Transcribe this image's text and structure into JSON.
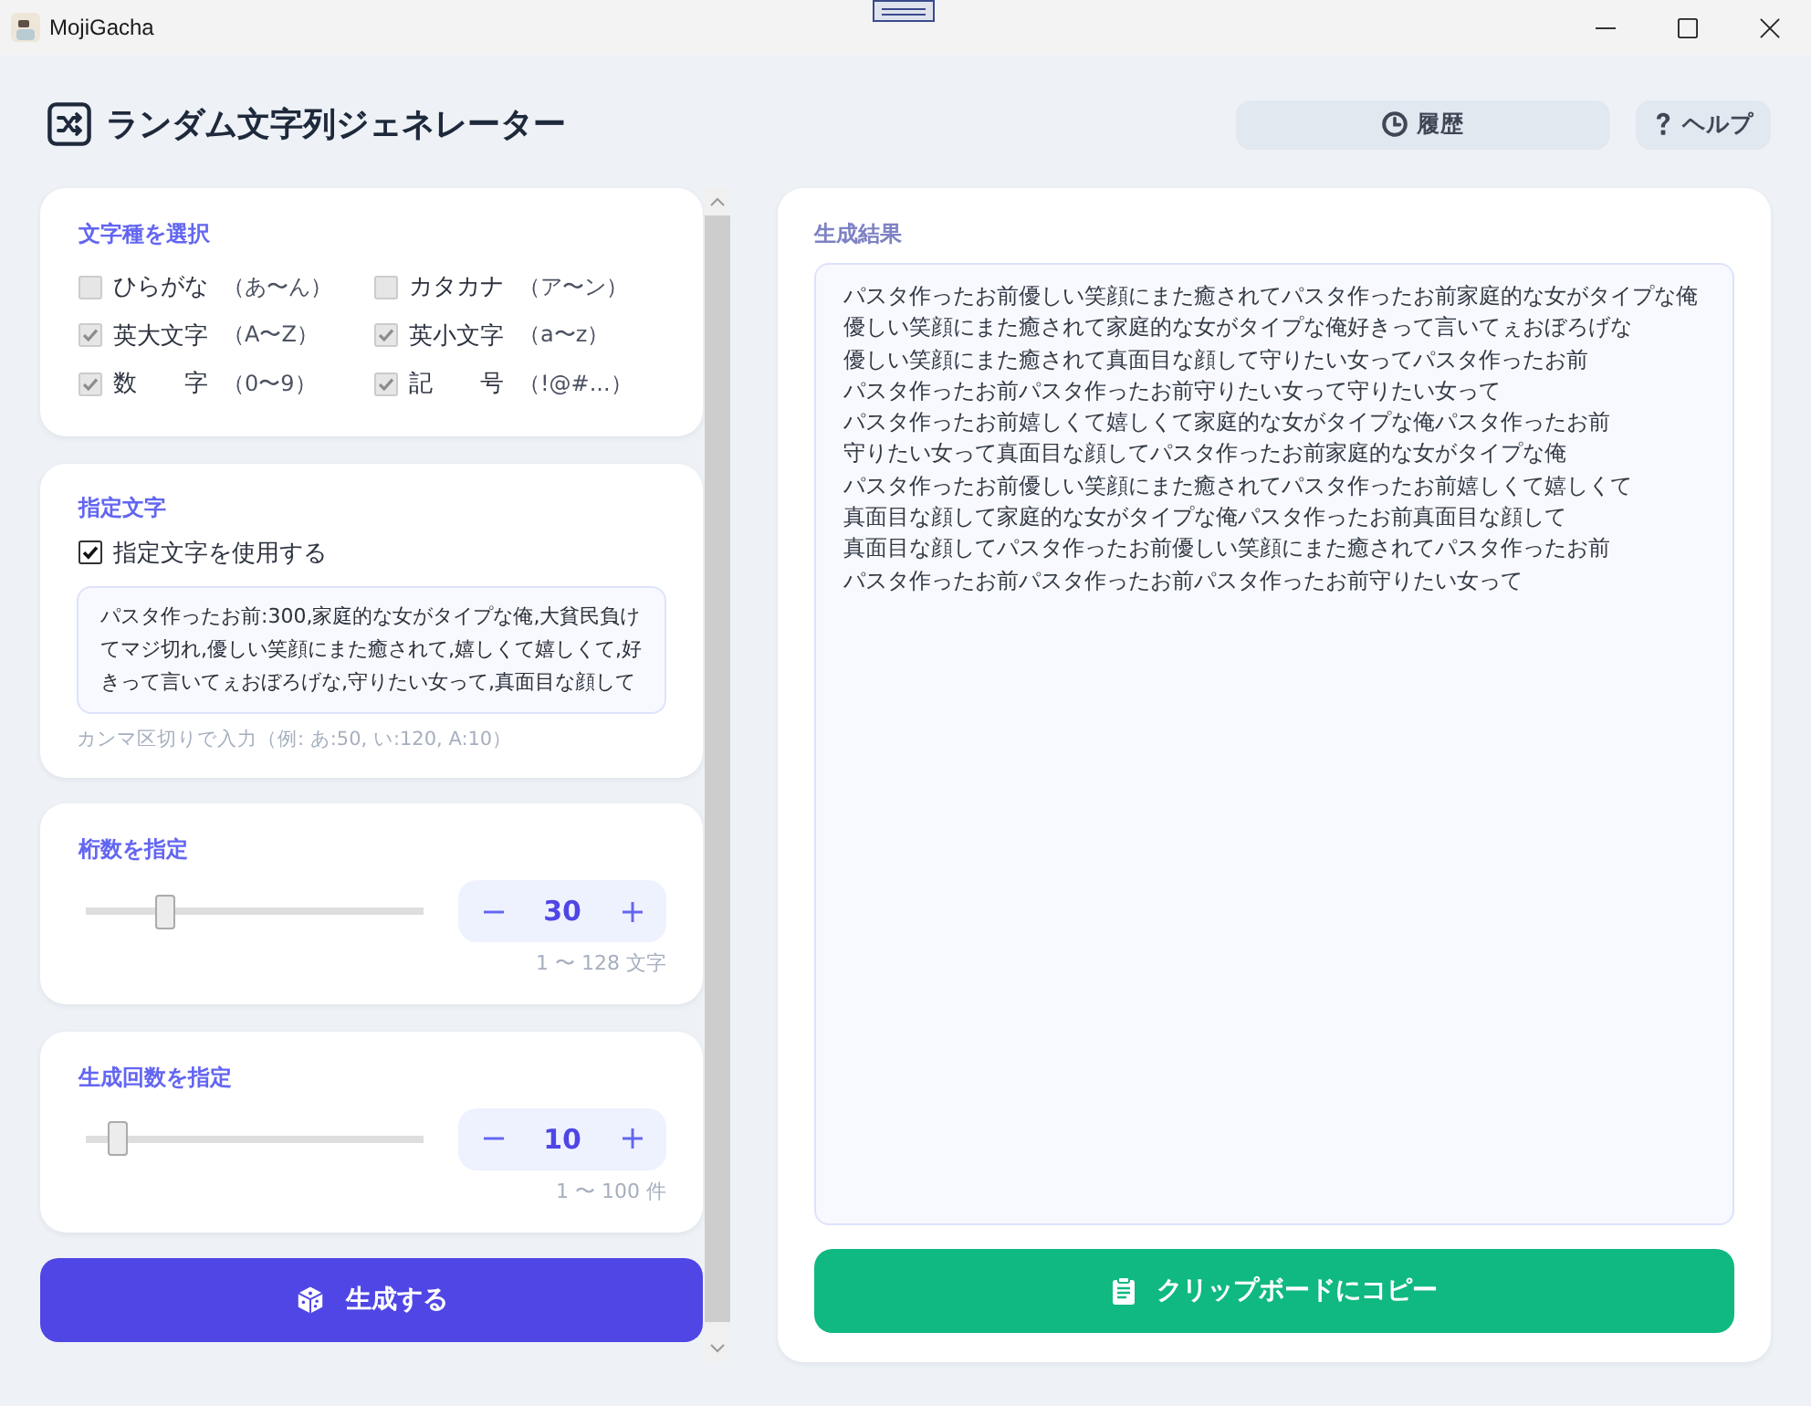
{
  "window": {
    "title": "MojiGacha"
  },
  "header": {
    "title": "ランダム文字列ジェネレーター",
    "buttons": [
      {
        "kind": "history",
        "label": "履歴"
      },
      {
        "kind": "help",
        "label": "ヘルプ"
      }
    ]
  },
  "char_types": {
    "title": "文字種を選択",
    "options": [
      {
        "label": "ひらがな",
        "range": "（あ〜ん）",
        "checked": false,
        "disabled": true
      },
      {
        "label": "カタカナ",
        "range": "（ア〜ン）",
        "checked": false,
        "disabled": true
      },
      {
        "label": "英大文字",
        "range": "（A〜Z）",
        "checked": true,
        "disabled": true
      },
      {
        "label": "英小文字",
        "range": "（a〜z）",
        "checked": true,
        "disabled": true
      },
      {
        "label": "数　　字",
        "range": "（0〜9）",
        "checked": true,
        "disabled": true
      },
      {
        "label": "記　　号",
        "range": "（!@#...）",
        "checked": true,
        "disabled": true
      }
    ]
  },
  "custom_chars": {
    "title": "指定文字",
    "use_label": "指定文字を使用する",
    "use_checked": true,
    "value": "パスタ作ったお前:300,家庭的な女がタイプな俺,大貧民負けてマジ切れ,優しい笑顔にまた癒されて,嬉しくて嬉しくて,好きって言いてぇおぼろげな,守りたい女って,真面目な顔して",
    "hint": "カンマ区切りで入力（例: あ:50, い:120, A:10）"
  },
  "length": {
    "title": "桁数を指定",
    "level": 0.22,
    "value": "30",
    "range": "1 〜 128 文字"
  },
  "count": {
    "title": "生成回数を指定",
    "level": 0.07,
    "value": "10",
    "range": "1 〜 100 件"
  },
  "generate_button": {
    "label": "生成する"
  },
  "result": {
    "title": "生成結果",
    "lines": [
      "パスタ作ったお前優しい笑顔にまた癒されてパスタ作ったお前家庭的な女がタイプな俺",
      "優しい笑顔にまた癒されて家庭的な女がタイプな俺好きって言いてぇおぼろげな",
      "優しい笑顔にまた癒されて真面目な顔して守りたい女ってパスタ作ったお前",
      "パスタ作ったお前パスタ作ったお前守りたい女って守りたい女って",
      "パスタ作ったお前嬉しくて嬉しくて家庭的な女がタイプな俺パスタ作ったお前",
      "守りたい女って真面目な顔してパスタ作ったお前家庭的な女がタイプな俺",
      "パスタ作ったお前優しい笑顔にまた癒されてパスタ作ったお前嬉しくて嬉しくて",
      "真面目な顔して家庭的な女がタイプな俺パスタ作ったお前真面目な顔して",
      "真面目な顔してパスタ作ったお前優しい笑顔にまた癒されてパスタ作ったお前",
      "パスタ作ったお前パスタ作ったお前パスタ作ったお前守りたい女って"
    ]
  },
  "copy_button": {
    "label": "クリップボードにコピー"
  }
}
